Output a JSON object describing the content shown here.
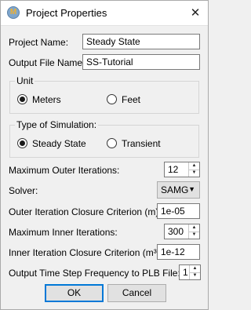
{
  "window": {
    "title": "Project Properties",
    "close_glyph": "✕",
    "icon_letter": "M"
  },
  "fields": {
    "project_name": {
      "label": "Project Name:",
      "value": "Steady State"
    },
    "output_file_name": {
      "label": "Output File Name:",
      "value": "SS-Tutorial"
    }
  },
  "unit": {
    "legend": "Unit",
    "options": [
      {
        "label": "Meters",
        "checked": true
      },
      {
        "label": "Feet",
        "checked": false
      }
    ]
  },
  "simulation": {
    "legend": "Type of Simulation:",
    "options": [
      {
        "label": "Steady State",
        "checked": true
      },
      {
        "label": "Transient",
        "checked": false
      }
    ]
  },
  "max_outer_iterations": {
    "label": "Maximum Outer Iterations:",
    "value": "12"
  },
  "solver": {
    "label": "Solver:",
    "value": "SAMG"
  },
  "outer_closure": {
    "label": "Outer Iteration Closure Criterion (m):",
    "value": "1e-05"
  },
  "max_inner_iterations": {
    "label": "Maximum Inner Iterations:",
    "value": "300"
  },
  "inner_closure": {
    "label": "Inner Iteration Closure Criterion (m³):",
    "value": "1e-12"
  },
  "output_freq": {
    "label": "Output Time Step Frequency to PLB File:",
    "value": "1"
  },
  "buttons": {
    "ok": "OK",
    "cancel": "Cancel"
  }
}
